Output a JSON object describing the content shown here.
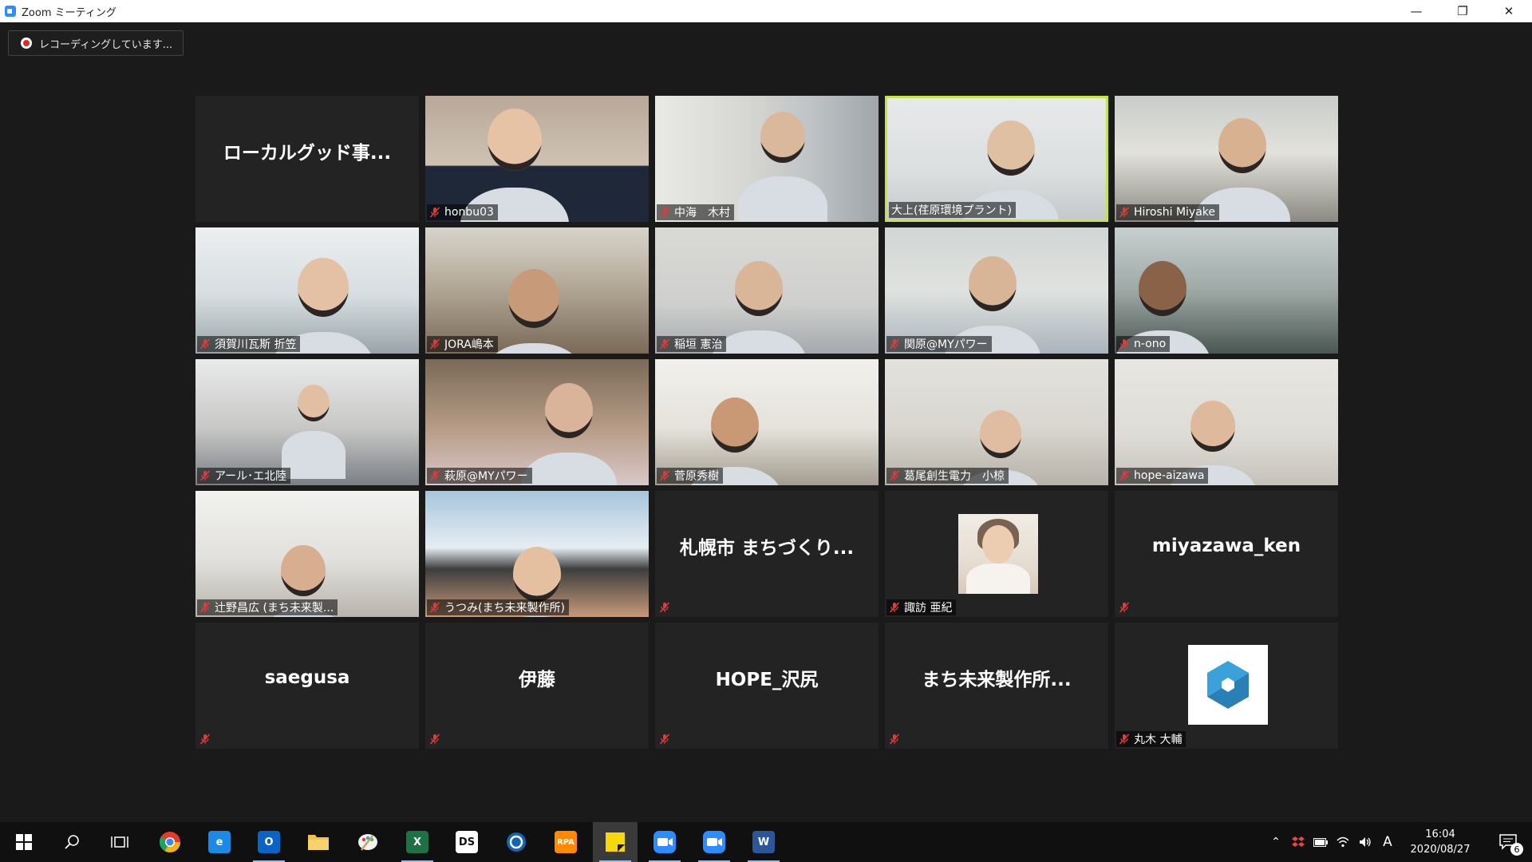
{
  "window": {
    "title": "Zoom ミーティング",
    "controls": {
      "minimize": "—",
      "restore": "❐",
      "close": "✕"
    }
  },
  "recording": {
    "label": "レコーディングしています..."
  },
  "colors": {
    "active_speaker": "#c7e34a",
    "mute_red": "#e03b3b",
    "zoom_blue": "#2d8cff"
  },
  "participants": [
    {
      "name": "",
      "display": "ローカルグッド事...",
      "video": false,
      "muted": false
    },
    {
      "name": "honbu03",
      "video": true,
      "muted": true
    },
    {
      "name": "中海　木村",
      "video": true,
      "muted": true
    },
    {
      "name": "大上(荏原環境プラント)",
      "video": true,
      "muted": false,
      "active_speaker": true
    },
    {
      "name": "Hiroshi Miyake",
      "video": true,
      "muted": true
    },
    {
      "name": "須賀川瓦斯 折笠",
      "video": true,
      "muted": true
    },
    {
      "name": "JORA嶋本",
      "video": true,
      "muted": true
    },
    {
      "name": "稲垣 憲治",
      "video": true,
      "muted": true
    },
    {
      "name": "関原@MYパワー",
      "video": true,
      "muted": true
    },
    {
      "name": "n-ono",
      "video": true,
      "muted": true
    },
    {
      "name": "アール･エ北陸",
      "video": true,
      "muted": true
    },
    {
      "name": "萩原@MYパワー",
      "video": true,
      "muted": true
    },
    {
      "name": "菅原秀樹",
      "video": true,
      "muted": true
    },
    {
      "name": "葛尾創生電力　小椋",
      "video": true,
      "muted": true
    },
    {
      "name": "hope-aizawa",
      "video": true,
      "muted": true
    },
    {
      "name": "辻野昌広 (まち未来製...",
      "video": true,
      "muted": true
    },
    {
      "name": "うつみ(まち未来製作所)",
      "video": true,
      "muted": true
    },
    {
      "name": "",
      "display": "札幌市 まちづくり...",
      "video": false,
      "muted": true
    },
    {
      "name": "諏訪 亜紀",
      "video": false,
      "avatar": "photo",
      "muted": true
    },
    {
      "name": "",
      "display": "miyazawa_ken",
      "video": false,
      "muted": true
    },
    {
      "name": "",
      "display": "saegusa",
      "video": false,
      "muted": true
    },
    {
      "name": "",
      "display": "伊藤",
      "video": false,
      "muted": true
    },
    {
      "name": "",
      "display": "HOPE_沢尻",
      "video": false,
      "muted": true
    },
    {
      "name": "",
      "display": "まち未来製作所...",
      "video": false,
      "muted": true
    },
    {
      "name": "丸木 大輔",
      "video": false,
      "avatar": "logo",
      "muted": true
    }
  ],
  "taskbar": {
    "apps": [
      {
        "id": "start",
        "icon": "windows-start-icon"
      },
      {
        "id": "search",
        "icon": "search-icon"
      },
      {
        "id": "taskview",
        "icon": "task-view-icon"
      },
      {
        "id": "chrome",
        "icon": "chrome-icon"
      },
      {
        "id": "ie",
        "icon": "internet-explorer-icon",
        "label": "e"
      },
      {
        "id": "outlook",
        "icon": "outlook-icon",
        "label": "O"
      },
      {
        "id": "explorer",
        "icon": "file-explorer-icon"
      },
      {
        "id": "paint",
        "icon": "paint-icon"
      },
      {
        "id": "excel",
        "icon": "excel-icon",
        "label": "X"
      },
      {
        "id": "ds",
        "icon": "ds-icon",
        "label": "DS"
      },
      {
        "id": "circle",
        "icon": "circle-app-icon"
      },
      {
        "id": "rpa",
        "icon": "rpa-icon",
        "label": "RPA"
      },
      {
        "id": "sticky",
        "icon": "sticky-notes-icon"
      },
      {
        "id": "zoom1",
        "icon": "zoom-icon"
      },
      {
        "id": "zoom2",
        "icon": "zoom-icon"
      },
      {
        "id": "word",
        "icon": "word-icon",
        "label": "W"
      }
    ],
    "ime": "A",
    "clock": {
      "time": "16:04",
      "date": "2020/08/27"
    },
    "notifications": "6"
  }
}
